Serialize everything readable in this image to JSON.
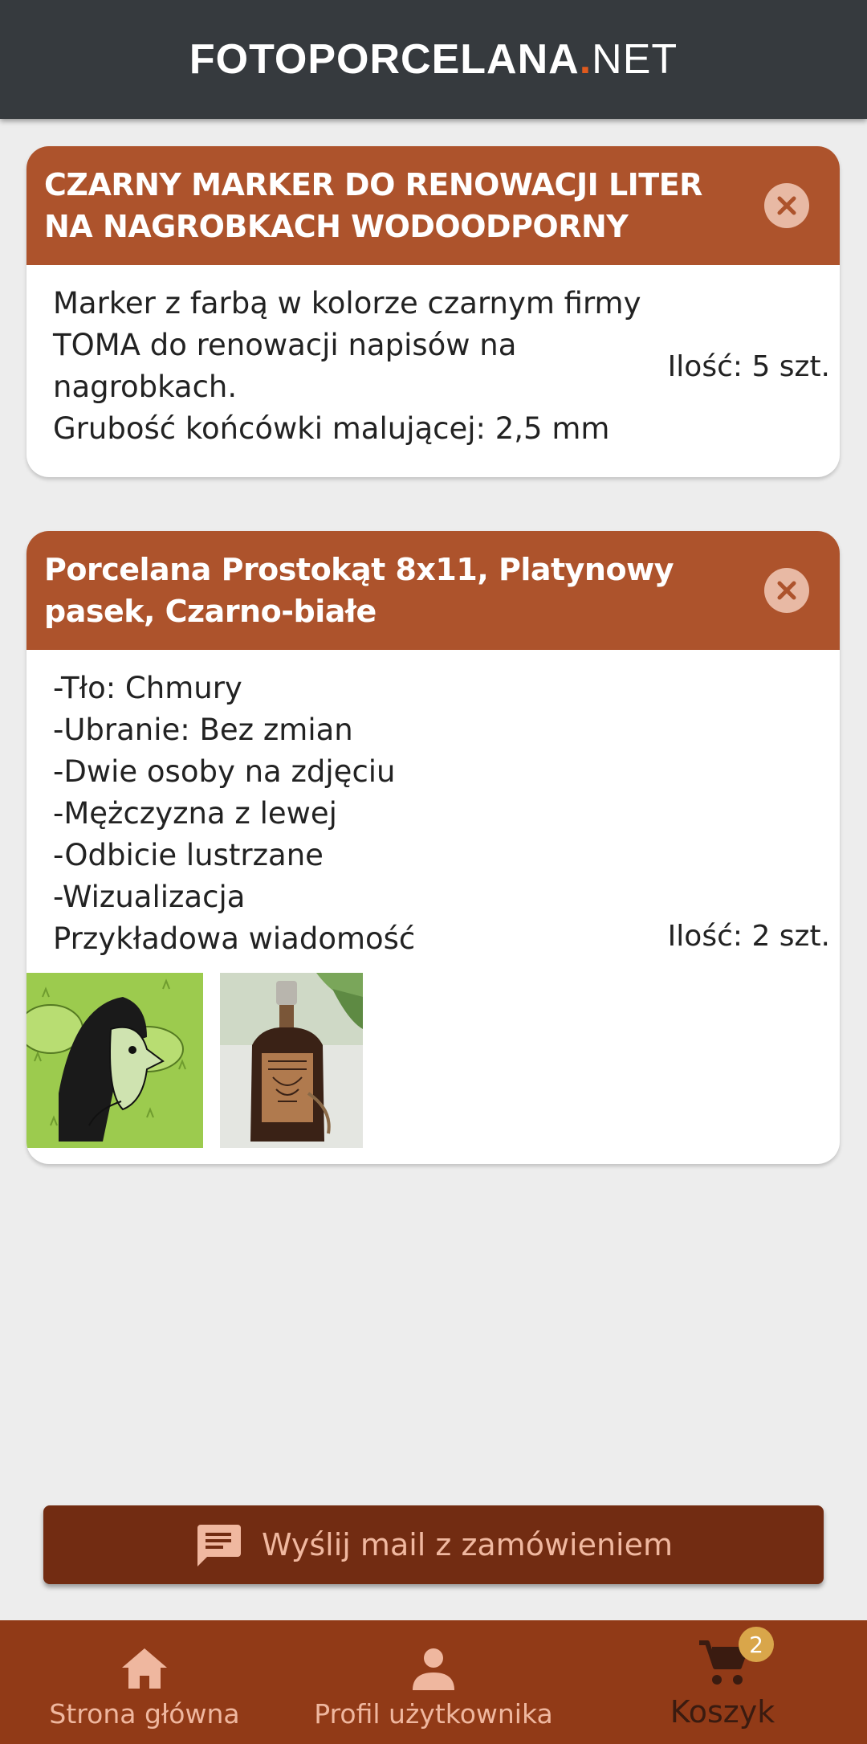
{
  "header": {
    "logo_main": "FOTOPORCELANA",
    "logo_dot": ".",
    "logo_suffix": "NET"
  },
  "cart_items": [
    {
      "title": "CZARNY MARKER DO RENOWACJI LITER NA NAGROBKACH WODOODPORNY",
      "description": "Marker z farbą w kolorze czarnym firmy TOMA do renowacji napisów na nagrobkach.\nGrubość końcówki malującej: 2,5 mm",
      "quantity": "Ilość: 5 szt."
    },
    {
      "title": "Porcelana Prostokąt 8x11, Platynowy pasek, Czarno-białe",
      "description": "-Tło: Chmury\n-Ubranie: Bez zmian\n-Dwie osoby na zdjęciu\n-Mężczyzna z lewej\n-Odbicie lustrzane\n-Wizualizacja\nPrzykładowa wiadomość",
      "quantity": "Ilość: 2 szt."
    }
  ],
  "actions": {
    "send_mail_label": "Wyślij mail z zamówieniem"
  },
  "bottom_nav": {
    "home_label": "Strona główna",
    "profile_label": "Profil użytkownika",
    "cart_label": "Koszyk",
    "cart_badge": "2"
  },
  "colors": {
    "card_header": "#ad532c",
    "top_bar": "#363a3e",
    "send_button": "#722c12",
    "bottom_nav": "#913a17",
    "badge": "#d9a64a"
  }
}
